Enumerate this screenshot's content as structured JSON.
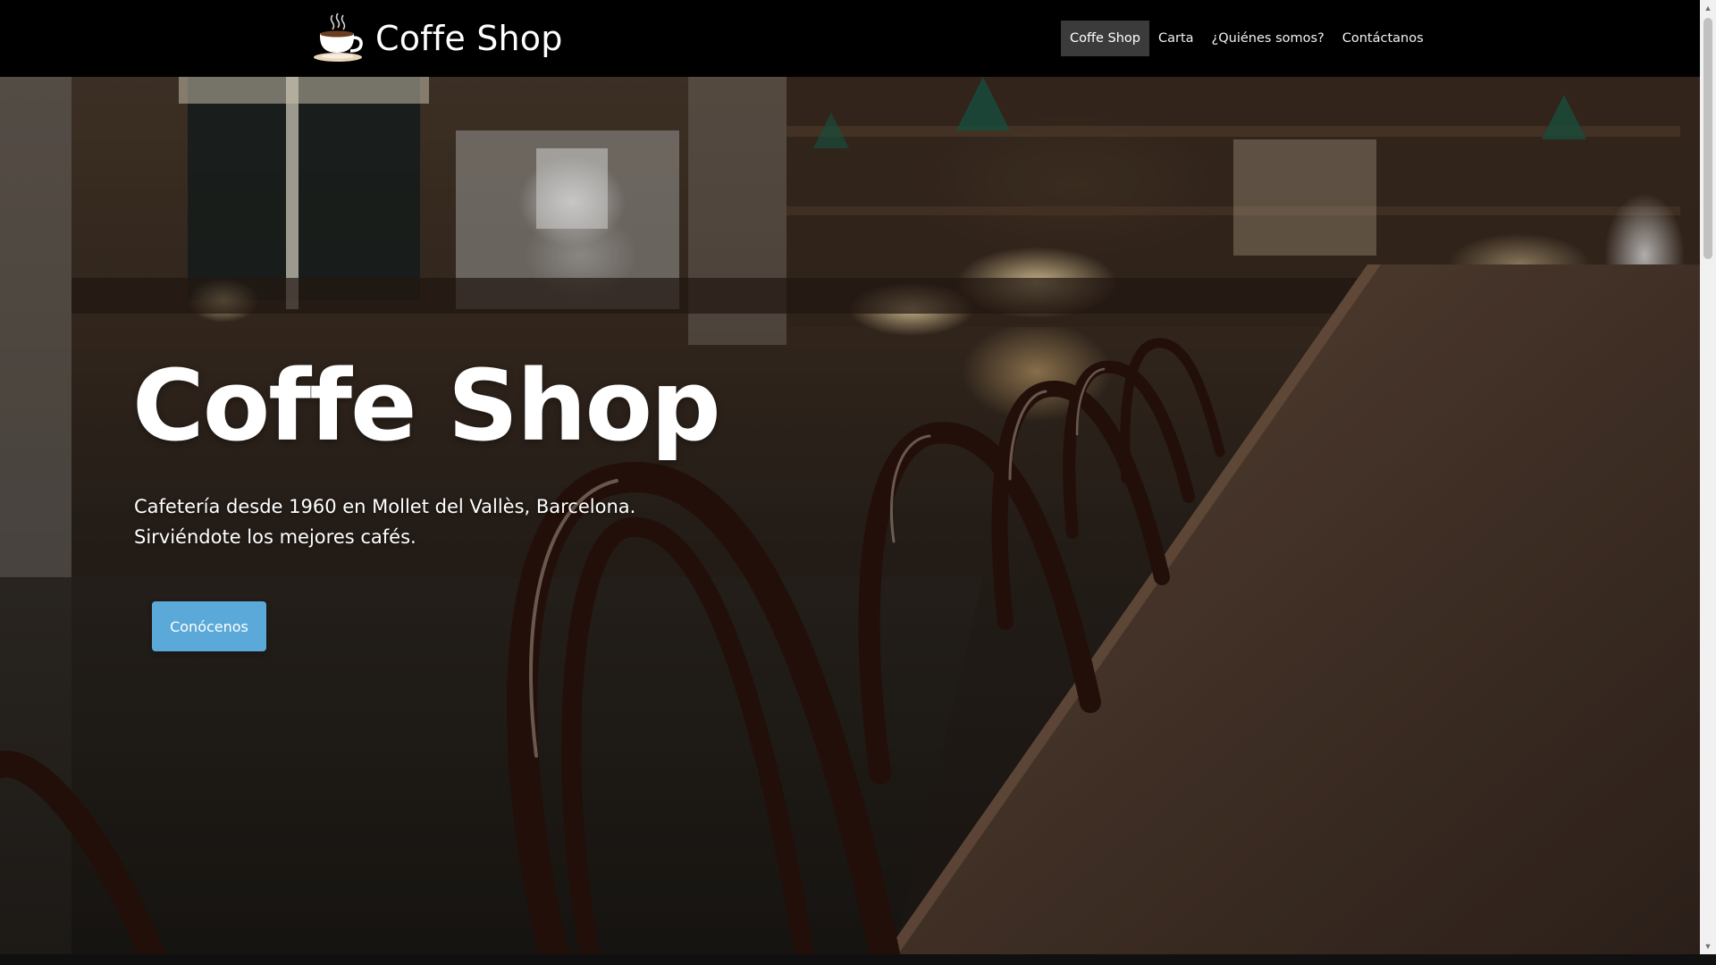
{
  "navbar": {
    "brand_text": "Coffe Shop",
    "brand_icon": "coffee-cup-icon",
    "links": [
      {
        "label": "Coffe Shop",
        "active": true
      },
      {
        "label": "Carta",
        "active": false
      },
      {
        "label": "¿Quiénes somos?",
        "active": false
      },
      {
        "label": "Contáctanos",
        "active": false
      }
    ]
  },
  "hero": {
    "title": "Coffe Shop",
    "description_lines": [
      "Cafetería desde 1960 en Mollet del Vallès, Barcelona.",
      "Sirviéndote los mejores cafés."
    ],
    "cta_label": "Conócenos",
    "background_image": "café interior with wooden bar counter and bentwood chairs"
  },
  "colors": {
    "navbar_bg": "#000000",
    "nav_active_bg": "#3b3b3b",
    "cta_bg": "#5aa9d8",
    "text": "#ffffff"
  }
}
